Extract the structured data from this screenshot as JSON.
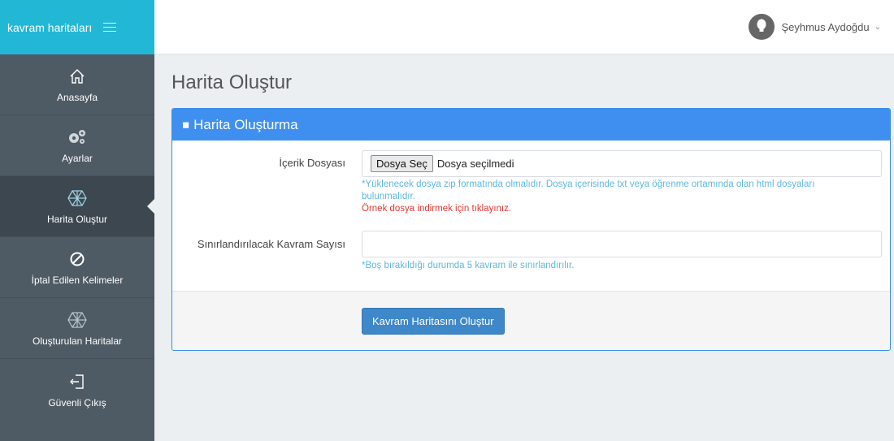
{
  "brand": {
    "title": "kavram haritaları"
  },
  "sidebar": {
    "items": [
      {
        "label": "Anasayfa",
        "icon": "home-icon"
      },
      {
        "label": "Ayarlar",
        "icon": "gears-icon"
      },
      {
        "label": "Harita Oluştur",
        "icon": "hexagon-network-icon",
        "active": true
      },
      {
        "label": "İptal Edilen Kelimeler",
        "icon": "ban-icon"
      },
      {
        "label": "Oluşturulan Haritalar",
        "icon": "hexagon-network-icon"
      },
      {
        "label": "Güvenli Çıkış",
        "icon": "logout-icon"
      }
    ]
  },
  "user": {
    "name": "Şeyhmus Aydoğdu"
  },
  "page": {
    "title": "Harita Oluştur"
  },
  "panel": {
    "heading": "Harita Oluşturma",
    "file_field": {
      "label": "İçerik Dosyası",
      "button_label": "Dosya Seç",
      "status": "Dosya seçilmedi",
      "help": "*Yüklenecek dosya zip formatında olmalıdır. Dosya içerisinde txt veya öğrenme ortamında olan html dosyaları bulunmalıdır.",
      "sample_link": "Örnek dosya indirmek için tıklayınız."
    },
    "limit_field": {
      "label": "Sınırlandırılacak Kavram Sayısı",
      "value": "",
      "help": "*Boş bırakıldığı durumda 5 kavram ile sınırlandırılır."
    },
    "submit_label": "Kavram Haritasını Oluştur"
  },
  "colors": {
    "brand": "#23b7d6",
    "sidebar": "#4e5a64",
    "panel_heading": "#3f8ff0",
    "button": "#3e88c9",
    "help_text": "#5fb8de",
    "link_red": "#e53935"
  }
}
